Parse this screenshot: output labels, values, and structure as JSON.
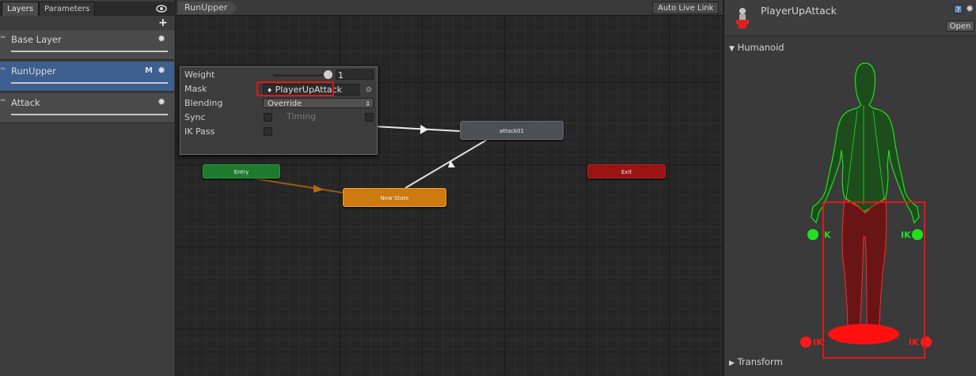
{
  "left_panel": {
    "tabs": [
      "Layers",
      "Parameters"
    ],
    "add_label": "+",
    "layers": [
      {
        "name": "Base Layer",
        "selected": false
      },
      {
        "name": "RunUpper",
        "selected": true,
        "badge": "M"
      },
      {
        "name": "Attack",
        "selected": false
      }
    ]
  },
  "graph": {
    "breadcrumb": "RunUpper",
    "auto_live_link": "Auto Live Link",
    "nodes": {
      "attack": "attack01",
      "entry": "Entry",
      "exit": "Exit",
      "new_state": "New State"
    }
  },
  "layer_settings": {
    "weight_label": "Weight",
    "weight_value": "1",
    "weight_fraction": 1.0,
    "mask_label": "Mask",
    "mask_value": "PlayerUpAttack",
    "blending_label": "Blending",
    "blending_value": "Override",
    "sync_label": "Sync",
    "timing_label": "Timing",
    "ik_pass_label": "IK Pass",
    "highlight_color": "#e0161a"
  },
  "inspector": {
    "title": "PlayerUpAttack",
    "open_button": "Open",
    "humanoid_label": "Humanoid",
    "transform_label": "Transform",
    "ik_labels": {
      "left_hand": "K",
      "right_hand": "IK",
      "left_foot": "IK",
      "right_foot": "IK"
    },
    "colors": {
      "enabled": "#20e020",
      "disabled": "#ff1a1a"
    }
  }
}
